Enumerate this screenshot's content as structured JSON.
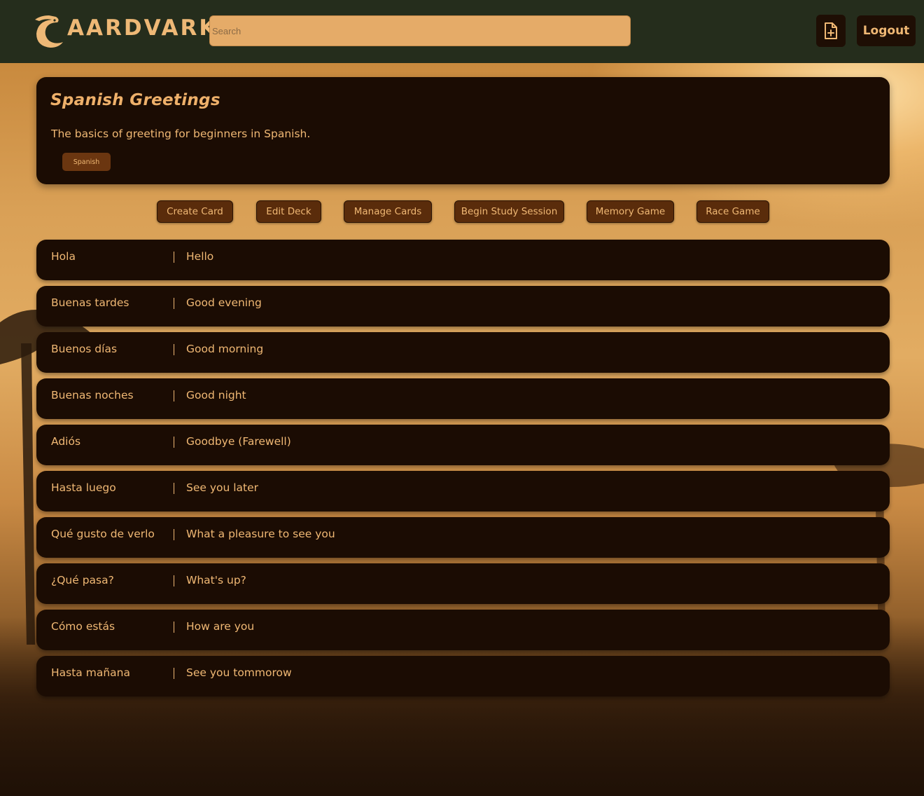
{
  "header": {
    "logo_text": "AARDVARK",
    "search_placeholder": "Search",
    "new_file_icon": "file-plus-icon",
    "logout_label": "Logout"
  },
  "deck": {
    "title": "Spanish Greetings",
    "description": "The basics of greeting for beginners in Spanish.",
    "tag": "Spanish"
  },
  "actions": {
    "create_card": "Create Card",
    "edit_deck": "Edit Deck",
    "manage_cards": "Manage Cards",
    "begin_study": "Begin Study Session",
    "memory_game": "Memory Game",
    "race_game": "Race Game"
  },
  "cards": [
    {
      "front": "Hola",
      "back": "Hello"
    },
    {
      "front": "Buenas tardes",
      "back": "Good evening"
    },
    {
      "front": "Buenos días",
      "back": "Good morning"
    },
    {
      "front": "Buenas noches",
      "back": "Good night"
    },
    {
      "front": "Adiós",
      "back": "Goodbye (Farewell)"
    },
    {
      "front": "Hasta luego",
      "back": "See you later"
    },
    {
      "front": "Qué gusto de verlo",
      "back": "What a pleasure to see you"
    },
    {
      "front": "¿Qué pasa?",
      "back": "What's up?"
    },
    {
      "front": "Cómo estás",
      "back": "How are you"
    },
    {
      "front": "Hasta mañana",
      "back": "See you tommorow"
    }
  ],
  "colors": {
    "header_bg": "#252d1c",
    "panel_bg": "#1b0c03",
    "accent_text": "#f0b874",
    "button_bg": "#5a2c0b",
    "search_bg": "#e5ab68"
  }
}
